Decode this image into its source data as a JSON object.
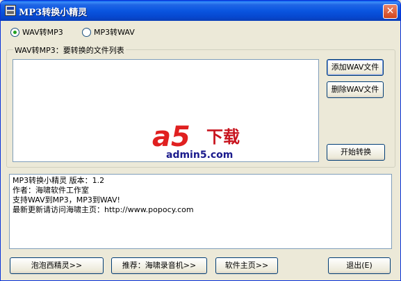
{
  "window": {
    "title": "MP3转换小精灵",
    "close_label": "✕"
  },
  "mode": {
    "options": [
      {
        "label": "WAV转MP3",
        "selected": true
      },
      {
        "label": "MP3转WAV",
        "selected": false
      }
    ]
  },
  "file_group": {
    "legend": "WAV转MP3：要转换的文件列表",
    "add_button": "添加WAV文件",
    "delete_button": "删除WAV文件",
    "start_button": "开始转换"
  },
  "watermark": {
    "logo_text": "a5",
    "cn_text": "下载",
    "url": "admin5.com"
  },
  "info": {
    "lines": [
      "MP3转换小精灵  版本：1.2",
      "作者：海啸软件工作室",
      "支持WAV到MP3，MP3到WAV!",
      "最新更新请访问海啸主页：http://www.popocy.com"
    ]
  },
  "bottom_buttons": {
    "paopao": "泡泡西精灵>>",
    "recommend": "推荐：海啸录音机>>",
    "homepage": "软件主页>>",
    "exit": "退出(E)"
  }
}
